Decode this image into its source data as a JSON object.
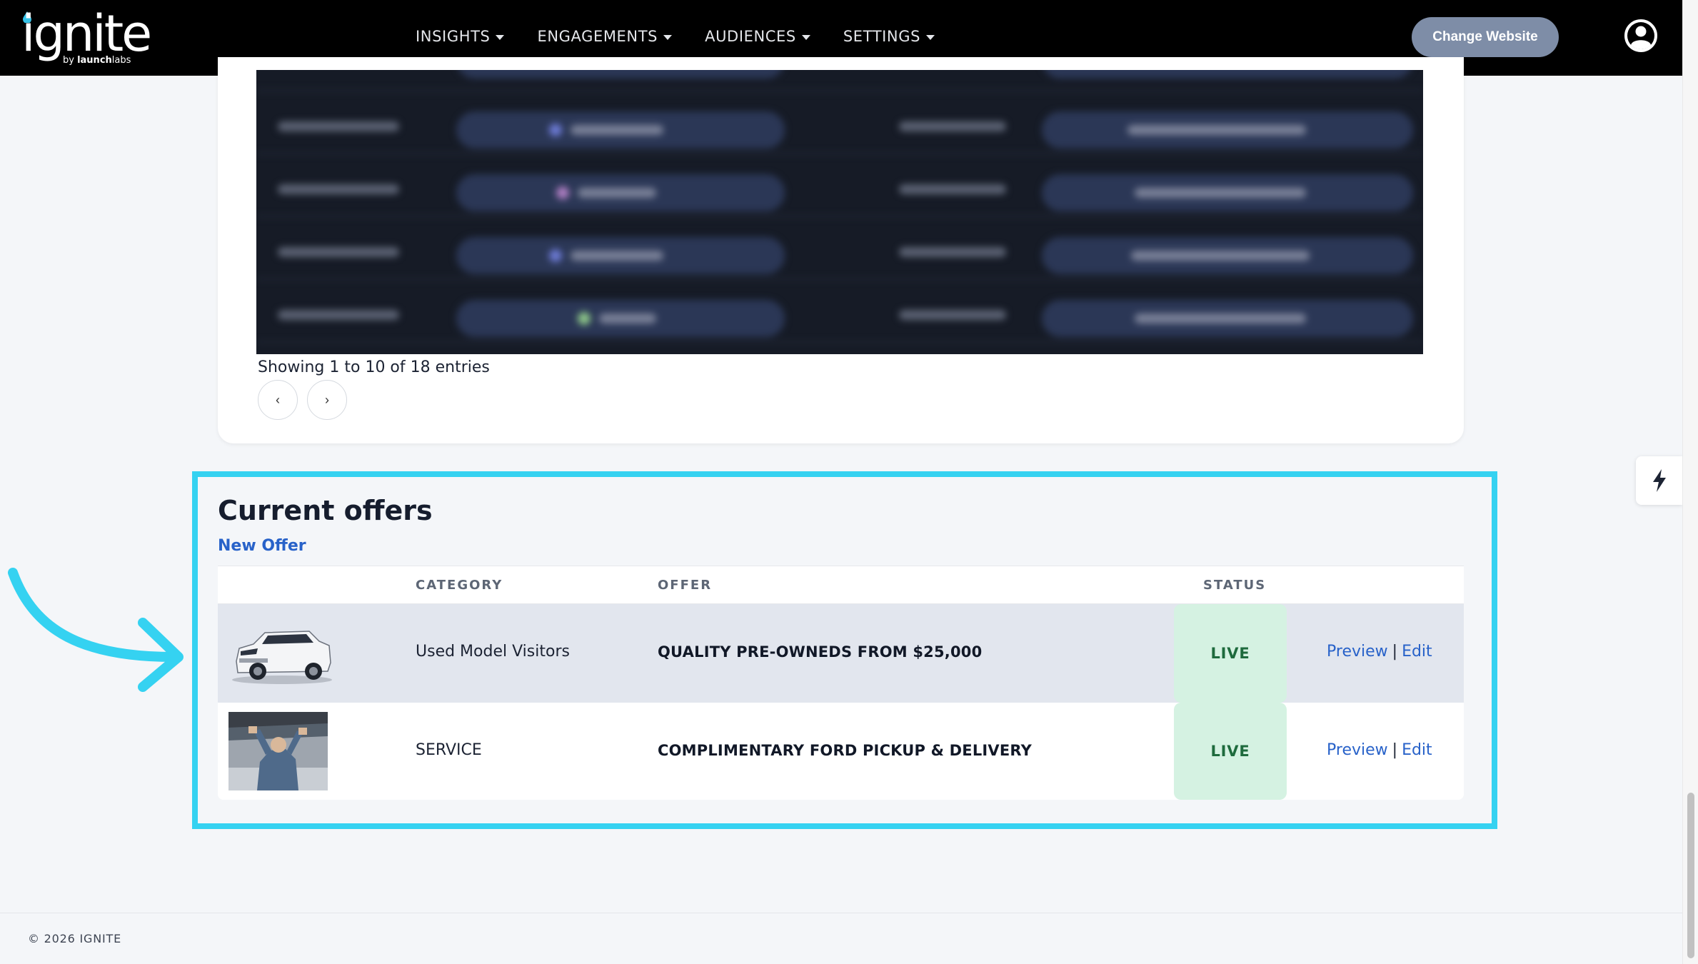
{
  "brand": {
    "name": "ignite",
    "byline_prefix": "by ",
    "byline_strong": "launch",
    "byline_rest": "labs"
  },
  "nav": {
    "items": [
      {
        "label": "INSIGHTS"
      },
      {
        "label": "ENGAGEMENTS"
      },
      {
        "label": "AUDIENCES"
      },
      {
        "label": "SETTINGS"
      }
    ],
    "change_website": "Change Website",
    "avatar_icon": "user-circle-icon"
  },
  "entries_table": {
    "info": "Showing 1 to 10 of 18 entries",
    "prev": "‹",
    "next": "›"
  },
  "offers": {
    "title": "Current offers",
    "new_offer": "New Offer",
    "columns": [
      "CATEGORY",
      "OFFER",
      "STATUS"
    ],
    "rows": [
      {
        "image": "white-suv-image",
        "category": "Used Model Visitors",
        "offer": "QUALITY PRE-OWNEDS FROM $25,000",
        "status": "LIVE",
        "preview": "Preview",
        "edit": "Edit"
      },
      {
        "image": "mechanic-under-vehicle-image",
        "category": "SERVICE",
        "offer": "COMPLIMENTARY FORD PICKUP & DELIVERY",
        "status": "LIVE",
        "preview": "Preview",
        "edit": "Edit"
      }
    ]
  },
  "footer": {
    "copyright": "© 2026 IGNITE"
  },
  "colors": {
    "highlight": "#35d2f1",
    "link": "#2862c9",
    "live_bg": "#d5f2e2",
    "live_text": "#1e6b3d",
    "nav_bg": "#000000",
    "button_bg": "#7e8da7"
  },
  "icons": [
    "lightning-bolt-icon",
    "user-circle-icon",
    "chevron-left-icon",
    "chevron-right-icon",
    "curved-arrow-icon"
  ]
}
